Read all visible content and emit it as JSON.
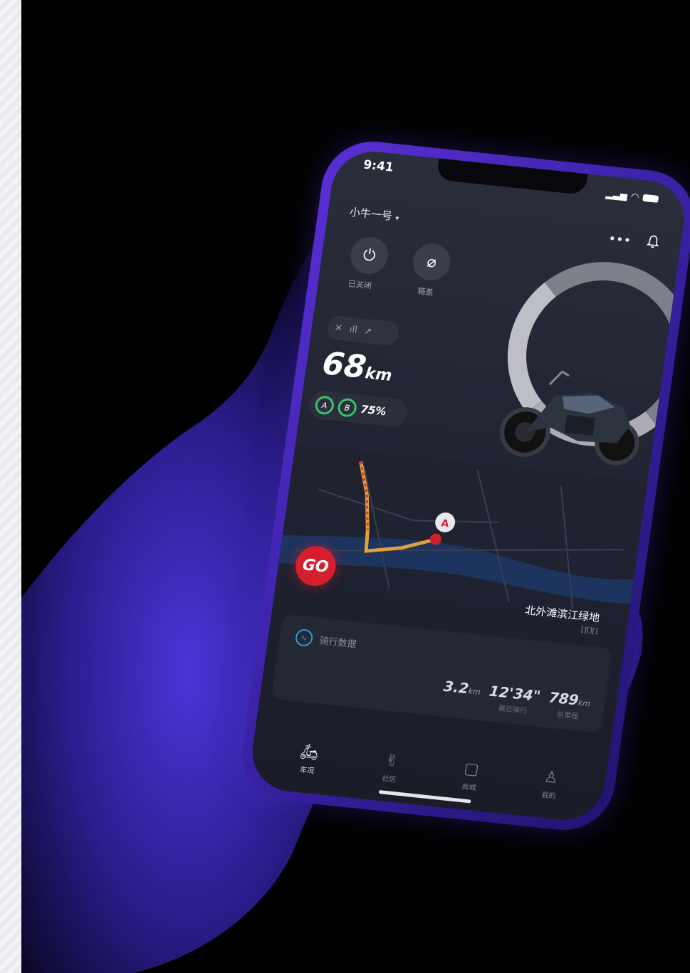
{
  "status_bar": {
    "time": "9:41"
  },
  "header": {
    "vehicle_name": "小牛一号",
    "vehicle_caret": "▾",
    "more_icon": "•••",
    "bell_icon": "♫"
  },
  "controls": {
    "power": {
      "icon": "⏻",
      "label": "已关闭"
    },
    "seat": {
      "icon": "⌀",
      "label": "箱盖"
    }
  },
  "range": {
    "value": "68",
    "unit": "km"
  },
  "battery": {
    "a_label": "A",
    "b_label": "B",
    "percent": "75%"
  },
  "map": {
    "go_label": "GO",
    "place_name": "北外滩滨江绿地",
    "place_sub": "[][][]"
  },
  "ride": {
    "title": "骑行数据",
    "stats": [
      {
        "value": "3.2",
        "unit": "km",
        "label": ""
      },
      {
        "value": "12'34\"",
        "unit": "",
        "label": "最近骑行"
      },
      {
        "value": "789",
        "unit": "km",
        "label": "总里程"
      }
    ]
  },
  "tabs": [
    {
      "label": "车况",
      "icon": "scooter-icon",
      "active": true
    },
    {
      "label": "社区",
      "icon": "hand-icon",
      "active": false
    },
    {
      "label": "商城",
      "icon": "bag-icon",
      "active": false
    },
    {
      "label": "我的",
      "icon": "user-icon",
      "active": false
    }
  ],
  "colors": {
    "accent_green": "#36c46a",
    "go_red": "#d4202c",
    "phone_body": "#4a28c4",
    "route": "#e0a040"
  }
}
